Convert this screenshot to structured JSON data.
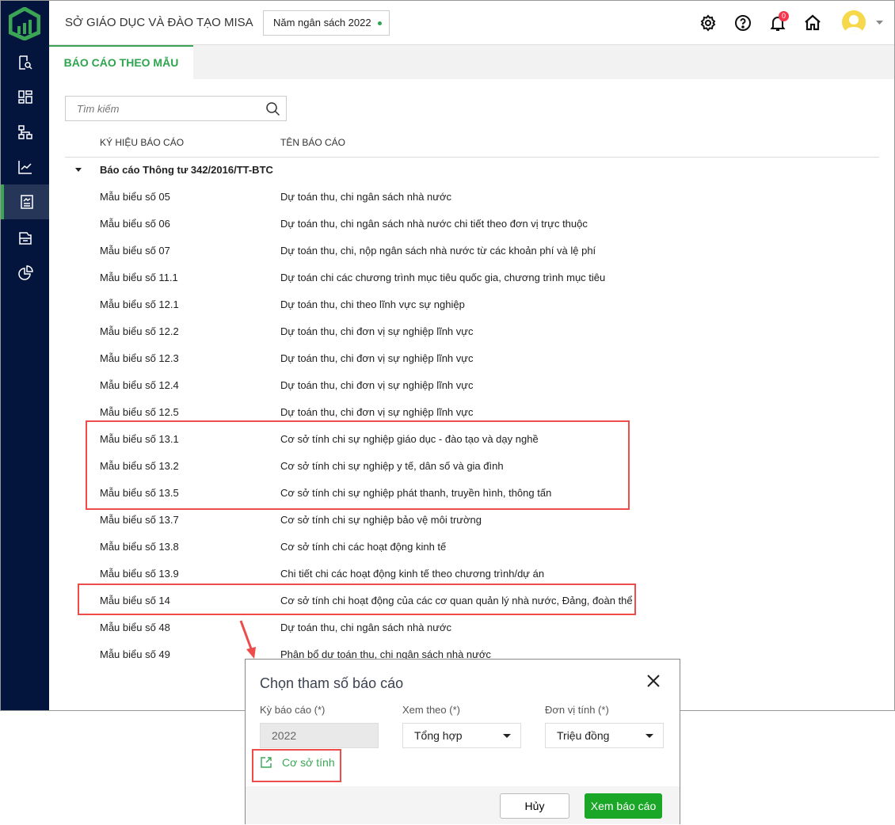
{
  "header": {
    "org": "SỞ GIÁO DỤC VÀ ĐÀO TẠO MISA",
    "budget_year": "Năm ngân sách 2022",
    "notification_count": "0",
    "icons": [
      "settings-icon",
      "help-icon",
      "bell-icon",
      "home-icon",
      "avatar",
      "chevron-down-icon"
    ]
  },
  "sidebar": {
    "items": [
      "search-document-icon",
      "dashboard-icon",
      "hierarchy-icon",
      "line-chart-icon",
      "report-icon",
      "inbox-icon",
      "pie-chart-icon"
    ],
    "active_index": 4,
    "accent": "#3aa655"
  },
  "tabs": [
    {
      "label": "BÁO CÁO THEO MẪU",
      "active": true
    }
  ],
  "search": {
    "placeholder": "Tìm kiếm"
  },
  "table": {
    "headers": [
      "KÝ HIỆU BÁO CÁO",
      "TÊN BÁO CÁO"
    ],
    "group": "Báo cáo Thông tư 342/2016/TT-BTC",
    "rows": [
      [
        "Mẫu biểu số 05",
        "Dự toán thu, chi ngân sách nhà nước"
      ],
      [
        "Mẫu biểu số 06",
        "Dự toán thu, chi ngân sách nhà nước chi tiết theo đơn vị trực thuộc"
      ],
      [
        "Mẫu biểu số 07",
        "Dự toán thu, chi, nộp ngân sách nhà nước từ các khoản phí và lệ phí"
      ],
      [
        "Mẫu biểu số 11.1",
        "Dự toán chi các chương trình mục tiêu quốc gia, chương trình mục tiêu"
      ],
      [
        "Mẫu biểu số 12.1",
        "Dự toán thu, chi theo lĩnh vực sự nghiệp"
      ],
      [
        "Mẫu biểu số 12.2",
        "Dự toán thu, chi đơn vị sự nghiệp lĩnh vực"
      ],
      [
        "Mẫu biểu số 12.3",
        "Dự toán thu, chi đơn vị sự nghiệp lĩnh vực"
      ],
      [
        "Mẫu biểu số 12.4",
        "Dự toán thu, chi đơn vị sự nghiệp lĩnh vực"
      ],
      [
        "Mẫu biểu số 12.5",
        "Dự toán thu, chi đơn vị sự nghiệp lĩnh vực"
      ],
      [
        "Mẫu biểu số 13.1",
        "Cơ sở tính chi sự nghiệp giáo dục - đào tạo và dạy nghề"
      ],
      [
        "Mẫu biểu số 13.2",
        "Cơ sở tính chi sự nghiệp y tế, dân số và gia đình"
      ],
      [
        "Mẫu biểu số 13.5",
        "Cơ sở tính chi sự nghiệp phát thanh, truyền hình, thông tấn"
      ],
      [
        "Mẫu biểu số 13.7",
        "Cơ sở tính chi sự nghiệp bảo vệ môi trường"
      ],
      [
        "Mẫu biểu số 13.8",
        "Cơ sở tính chi các hoạt động kinh tế"
      ],
      [
        "Mẫu biểu số 13.9",
        "Chi tiết chi các hoạt động kinh tế theo chương trình/dự án"
      ],
      [
        "Mẫu biểu số 14",
        "Cơ sở tính chi hoạt động của các cơ quan quản lý nhà nước, Đảng, đoàn thể"
      ],
      [
        "Mẫu biểu số 48",
        "Dự toán thu, chi ngân sách nhà nước"
      ],
      [
        "Mẫu biểu số 49",
        "Phân bổ dự toán thu, chi ngân sách nhà nước"
      ]
    ]
  },
  "dialog": {
    "title": "Chọn tham số báo cáo",
    "period_label": "Kỳ báo cáo (*)",
    "period_value": "2022",
    "view_label": "Xem theo (*)",
    "view_value": "Tổng hợp",
    "unit_label": "Đơn vị tính (*)",
    "unit_value": "Triệu đồng",
    "link": "Cơ sở tính",
    "cancel": "Hủy",
    "submit": "Xem báo cáo",
    "submit_color": "#1aa626"
  },
  "annotation_color": "#ee4b4b"
}
